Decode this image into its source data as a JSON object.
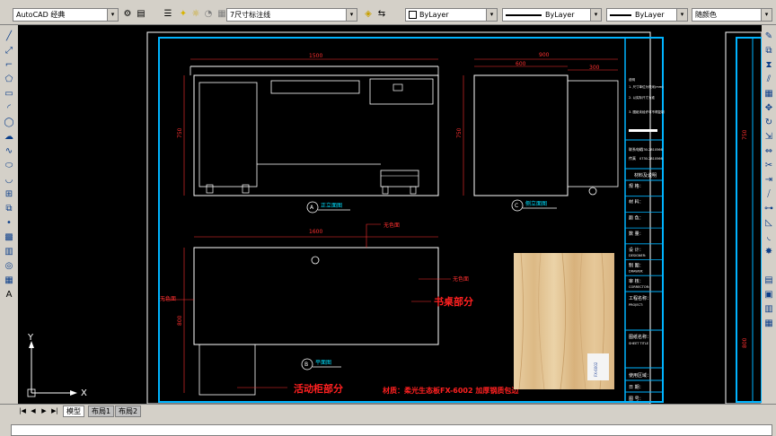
{
  "toolbar": {
    "workspace": "AutoCAD 经典",
    "layer": "7尺寸标注线",
    "color": "ByLayer",
    "linetype": "ByLayer",
    "lineweight": "ByLayer",
    "plotstyle": "随颜色"
  },
  "tabs": [
    {
      "label": "模型",
      "active": true
    },
    {
      "label": "布局1",
      "active": false
    },
    {
      "label": "布局2",
      "active": false
    }
  ],
  "ucs": {
    "x": "X",
    "y": "Y"
  },
  "drawing": {
    "front_width": "1500",
    "front_height": "750",
    "front_label_letter": "A",
    "front_label": "正立面图",
    "side_total": "900",
    "side_main": "600",
    "side_extra": "300",
    "side_height": "750",
    "side_label_letter": "C",
    "side_label": "侧立面图",
    "plan_width": "1600",
    "plan_depth": "800",
    "plan_label_letter": "B",
    "plan_label": "平面图",
    "callout_1": "无色面",
    "callout_2": "无色面",
    "callout_3": "无色面",
    "desk_part": "书桌部分",
    "cabinet_part": "活动柜部分",
    "material_note": "材质：柔光生态板FX-6002  加厚钢质包边",
    "swatch_label": "FX-6002"
  },
  "title_block": {
    "notes_title": "说明",
    "note_1": "1. 尺寸单位为毫米(mm)",
    "note_2": "2. 以实际尺寸为准",
    "note_3": "3. 图纸未经许可不得复制",
    "contact_label": "联系电话",
    "phone_1": "0730-2810566",
    "fax_label": "传真",
    "phone_2": "0730-2810566",
    "section_title": "材料及说明",
    "rows": [
      {
        "cn": "规 格：",
        "en": ""
      },
      {
        "cn": "材 料：",
        "en": ""
      },
      {
        "cn": "颜 色：",
        "en": ""
      },
      {
        "cn": "数 量：",
        "en": ""
      },
      {
        "cn": "设 计：",
        "en": "DESIGNER:"
      },
      {
        "cn": "制 图：",
        "en": "DRAWER:"
      },
      {
        "cn": "审 核：",
        "en": "CORRECTOR:"
      }
    ],
    "project_cn": "工程名称：",
    "project_en": "PROJECT:",
    "sheet_cn": "图纸名称：",
    "sheet_en": "SHEET TITLE :",
    "area_cn": "使用区域：",
    "date_cn": "日 期：",
    "number_cn": "图 号："
  }
}
